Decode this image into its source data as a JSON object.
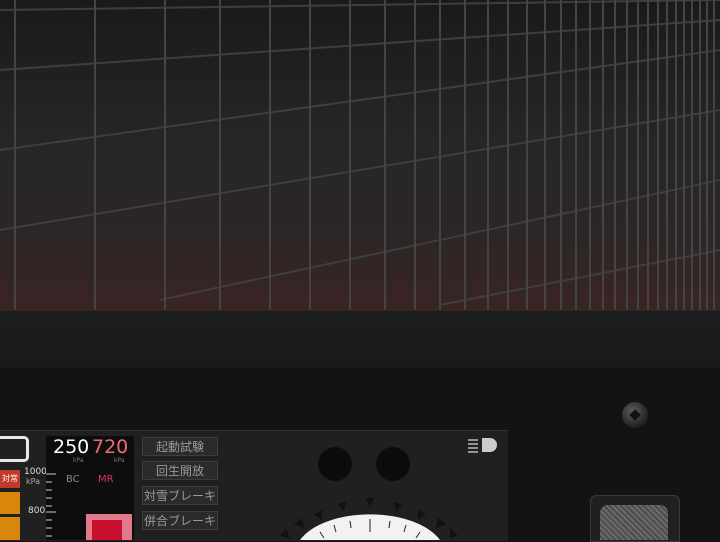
{
  "hud": {
    "bc_pressure": "250",
    "mr_pressure": "720",
    "unit_bc": "kPa",
    "unit_mr": "kPa",
    "bc_label": "BC",
    "mr_label": "MR",
    "scale_max": "1000",
    "scale_unit": "kPa",
    "scale_mark": "800",
    "alert_lamp": "対常"
  },
  "buttons": {
    "start_test": "起動試験",
    "regen_open": "回生開放",
    "snow_brake": "対雪ブレーキ",
    "combined_brake": "併合ブレーキ"
  },
  "colors": {
    "bc_value": "#ffffff",
    "mr_value": "#f06a7a",
    "accent": "#c8102e",
    "warning": "#d9870c"
  },
  "icons": {
    "headlight": "headlight-icon",
    "monitor": "monitor-icon"
  }
}
